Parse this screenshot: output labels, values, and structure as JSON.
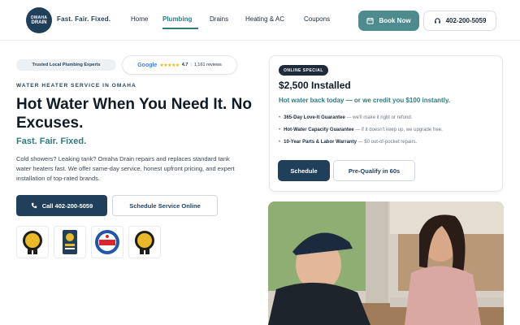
{
  "header": {
    "logo": {
      "top": "OMAHA",
      "bottom": "DRAIN"
    },
    "tagline": "Fast. Fair. Fixed.",
    "nav": [
      "Home",
      "Plumbing",
      "Drains",
      "Heating & AC",
      "Coupons"
    ],
    "active_nav": "Plumbing",
    "book_label": "Book Now",
    "phone_label": "402-200-5059"
  },
  "hero": {
    "trust_pill": "Trusted Local Plumbing Experts",
    "google": {
      "logo": "Google",
      "stars": "★★★★★",
      "rating": "4.7",
      "divider": "|",
      "reviews": "1,161 reviews"
    },
    "eyebrow": "WATER HEATER SERVICE IN OMAHA",
    "title": "Hot Water When You Need It. No Excuses.",
    "subtitle": "Fast. Fair. Fixed.",
    "body": "Cold showers? Leaking tank? Omaha Drain repairs and replaces standard tank water heaters fast. We offer same-day service, honest upfront pricing, and expert installation of top-rated brands.",
    "call_label": "Call 402-200-5059",
    "schedule_online_label": "Schedule Service Online"
  },
  "badges": [
    {
      "name": "award-badge-1",
      "color": "#1d1d1d"
    },
    {
      "name": "award-badge-2",
      "color": "#1f3f5b"
    },
    {
      "name": "award-badge-best",
      "color": "#2256a8"
    },
    {
      "name": "award-badge-4",
      "color": "#1d1d1d"
    }
  ],
  "offer": {
    "badge": "ONLINE SPECIAL",
    "price": "$2,500 Installed",
    "price_sub": "Hot water back today — or we credit you $100 instantly.",
    "bullets": [
      {
        "bold": "365-Day Love-It Guarantee",
        "rest": "— we'll make it right or refund."
      },
      {
        "bold": "Hot-Water Capacity Guarantee",
        "rest": "— if it doesn't keep up, we upgrade free."
      },
      {
        "bold": "10-Year Parts & Labor Warranty",
        "rest": "— $0 out-of-pocket repairs."
      }
    ],
    "schedule_label": "Schedule",
    "prequal_label": "Pre-Qualify in 60s"
  },
  "colors": {
    "primary": "#1f3f5b",
    "accent": "#2e7c7f",
    "book_button": "#4d8b8e",
    "star": "#f4b400"
  }
}
